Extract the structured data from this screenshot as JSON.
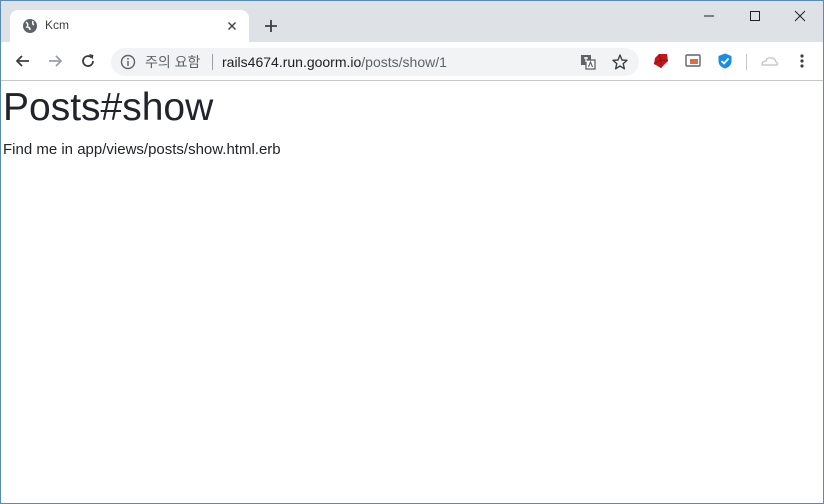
{
  "tab": {
    "title": "Kcm"
  },
  "omnibox": {
    "security_label": "주의 요함",
    "url_host": "rails4674.run.goorm.io",
    "url_path": "/posts/show/1"
  },
  "page": {
    "heading": "Posts#show",
    "body": "Find me in app/views/posts/show.html.erb"
  },
  "colors": {
    "tabstrip": "#dee1e6",
    "omnibox": "#f1f3f4",
    "text": "#212529"
  }
}
